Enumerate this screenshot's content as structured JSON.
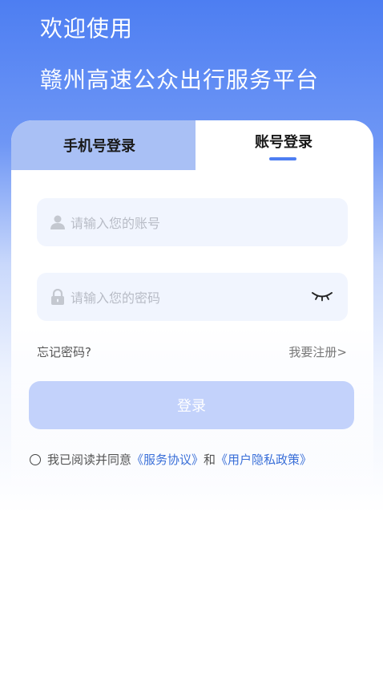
{
  "header": {
    "welcome": "欢迎使用",
    "platform_name": "赣州高速公众出行服务平台"
  },
  "tabs": {
    "phone_login": "手机号登录",
    "account_login": "账号登录"
  },
  "form": {
    "account_placeholder": "请输入您的账号",
    "password_placeholder": "请输入您的密码",
    "forgot_password": "忘记密码?",
    "register": "我要注册>",
    "login_button": "登录"
  },
  "agreement": {
    "prefix": "我已阅读并同意",
    "service": "《服务协议》",
    "and": "和",
    "privacy": "《用户隐私政策》"
  },
  "colors": {
    "brand": "#4d7ef2",
    "link": "#3a6fd8",
    "button_disabled": "#c3d2fb"
  },
  "icons": [
    "user-icon",
    "lock-icon",
    "eye-closed-icon"
  ]
}
